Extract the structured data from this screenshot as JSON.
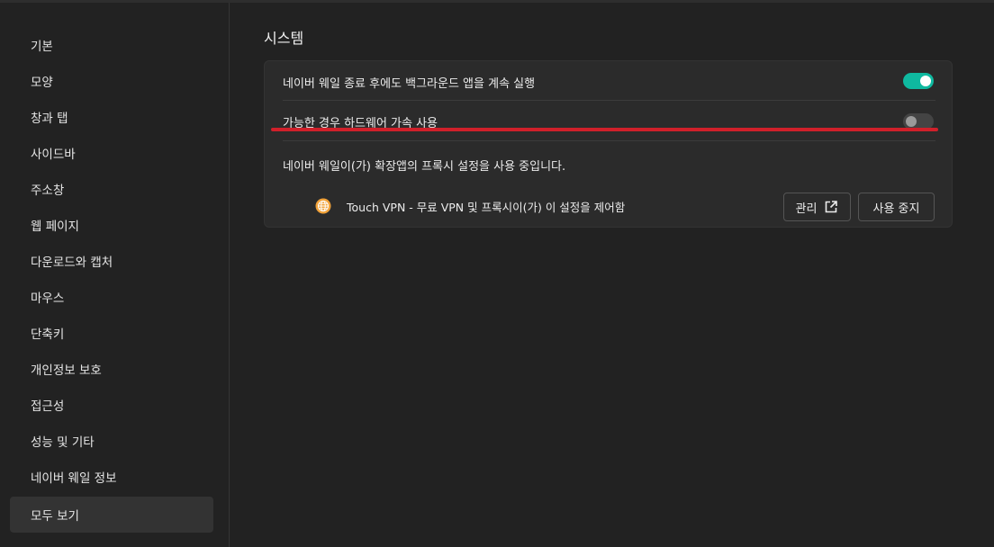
{
  "sidebar": {
    "items": [
      {
        "label": "기본"
      },
      {
        "label": "모양"
      },
      {
        "label": "창과 탭"
      },
      {
        "label": "사이드바"
      },
      {
        "label": "주소창"
      },
      {
        "label": "웹 페이지"
      },
      {
        "label": "다운로드와 캡처"
      },
      {
        "label": "마우스"
      },
      {
        "label": "단축키"
      },
      {
        "label": "개인정보 보호"
      },
      {
        "label": "접근성"
      },
      {
        "label": "성능 및 기타"
      },
      {
        "label": "네이버 웨일 정보"
      },
      {
        "label": "모두 보기"
      }
    ],
    "active_index": 13
  },
  "main": {
    "section_title": "시스템",
    "settings": [
      {
        "label": "네이버 웨일 종료 후에도 백그라운드 앱을 계속 실행",
        "enabled": true
      },
      {
        "label": "가능한 경우 하드웨어 가속 사용",
        "enabled": false
      }
    ],
    "proxy_notice": "네이버 웨일이(가) 확장앱의 프록시 설정을 사용 중입니다.",
    "extension": {
      "icon": "globe-icon",
      "text": "Touch VPN - 무료 VPN 및 프록시이(가) 이 설정을 제어함",
      "manage_label": "관리",
      "stop_label": "사용 중지"
    }
  },
  "colors": {
    "background": "#222222",
    "toggle_on": "#0fb9a0",
    "annotation_underline": "#d0202a"
  }
}
